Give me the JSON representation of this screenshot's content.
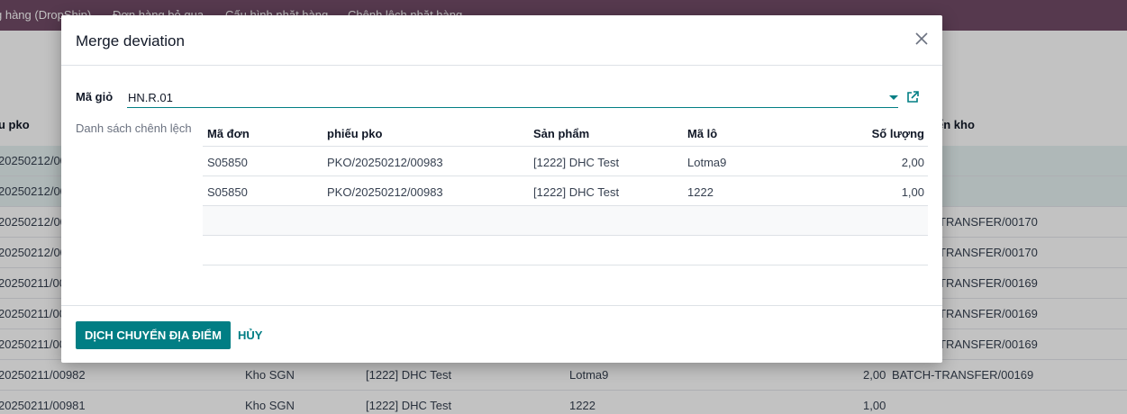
{
  "background": {
    "nav_items": [
      "g hàng (DropShip)",
      "Đơn hàng bỏ qua",
      "Cấu hình nhặt hàng",
      "Chênh lệch nhặt hàng"
    ],
    "col_heads": [
      "u pko",
      "ển kho"
    ],
    "rows": [
      {
        "c1": "20250212/00",
        "c2": "",
        "c3": "",
        "c4": "",
        "c5": "",
        "c6": "",
        "sel": true
      },
      {
        "c1": "20250212/00",
        "c2": "",
        "c3": "",
        "c4": "",
        "c5": "",
        "c6": "",
        "sel": true
      },
      {
        "c1": "20250212/00",
        "c2": "",
        "c3": "",
        "c4": "",
        "c5": "",
        "c6": "TRANSFER/00170"
      },
      {
        "c1": "20250212/00",
        "c2": "",
        "c3": "",
        "c4": "",
        "c5": "",
        "c6": "TRANSFER/00170"
      },
      {
        "c1": "20250211/00",
        "c2": "",
        "c3": "",
        "c4": "",
        "c5": "",
        "c6": "TRANSFER/00169"
      },
      {
        "c1": "20250211/00",
        "c2": "",
        "c3": "",
        "c4": "",
        "c5": "",
        "c6": "TRANSFER/00169"
      },
      {
        "c1": "20250211/00",
        "c2": "",
        "c3": "",
        "c4": "",
        "c5": "",
        "c6": "TRANSFER/00169"
      },
      {
        "c1": "20250211/00982",
        "c2": "Kho SGN",
        "c3": "[1222] DHC Test",
        "c4": "Lotma9",
        "c5": "2,00",
        "c6": "BATCH-TRANSFER/00169"
      },
      {
        "c1": "20250211/00981",
        "c2": "Kho SGN",
        "c3": "[1222] DHC Test",
        "c4": "1222",
        "c5": "1,00",
        "c6": ""
      }
    ]
  },
  "modal": {
    "title": "Merge deviation",
    "field_label": "Mã giỏ",
    "field_value": "HN.R.01",
    "list_label": "Danh sách chênh lệch",
    "columns": [
      "Mã đơn",
      "phiếu pko",
      "Sản phẩm",
      "Mã lô",
      "Số lượng"
    ],
    "rows": [
      {
        "ma_don": "S05850",
        "phieu": "PKO/20250212/00983",
        "san_pham": "[1222] DHC Test",
        "ma_lo": "Lotma9",
        "so_luong": "2,00"
      },
      {
        "ma_don": "S05850",
        "phieu": "PKO/20250212/00983",
        "san_pham": "[1222] DHC Test",
        "ma_lo": "1222",
        "so_luong": "1,00"
      }
    ],
    "primary_button": "DỊCH CHUYỂN ĐỊA ĐIỂM",
    "cancel_button": "HỦY"
  },
  "icons": {
    "close": "close-icon",
    "dropdown": "caret-down-icon",
    "external": "external-link-icon"
  },
  "colors": {
    "brand": "#714b67",
    "accent": "#017e84"
  }
}
